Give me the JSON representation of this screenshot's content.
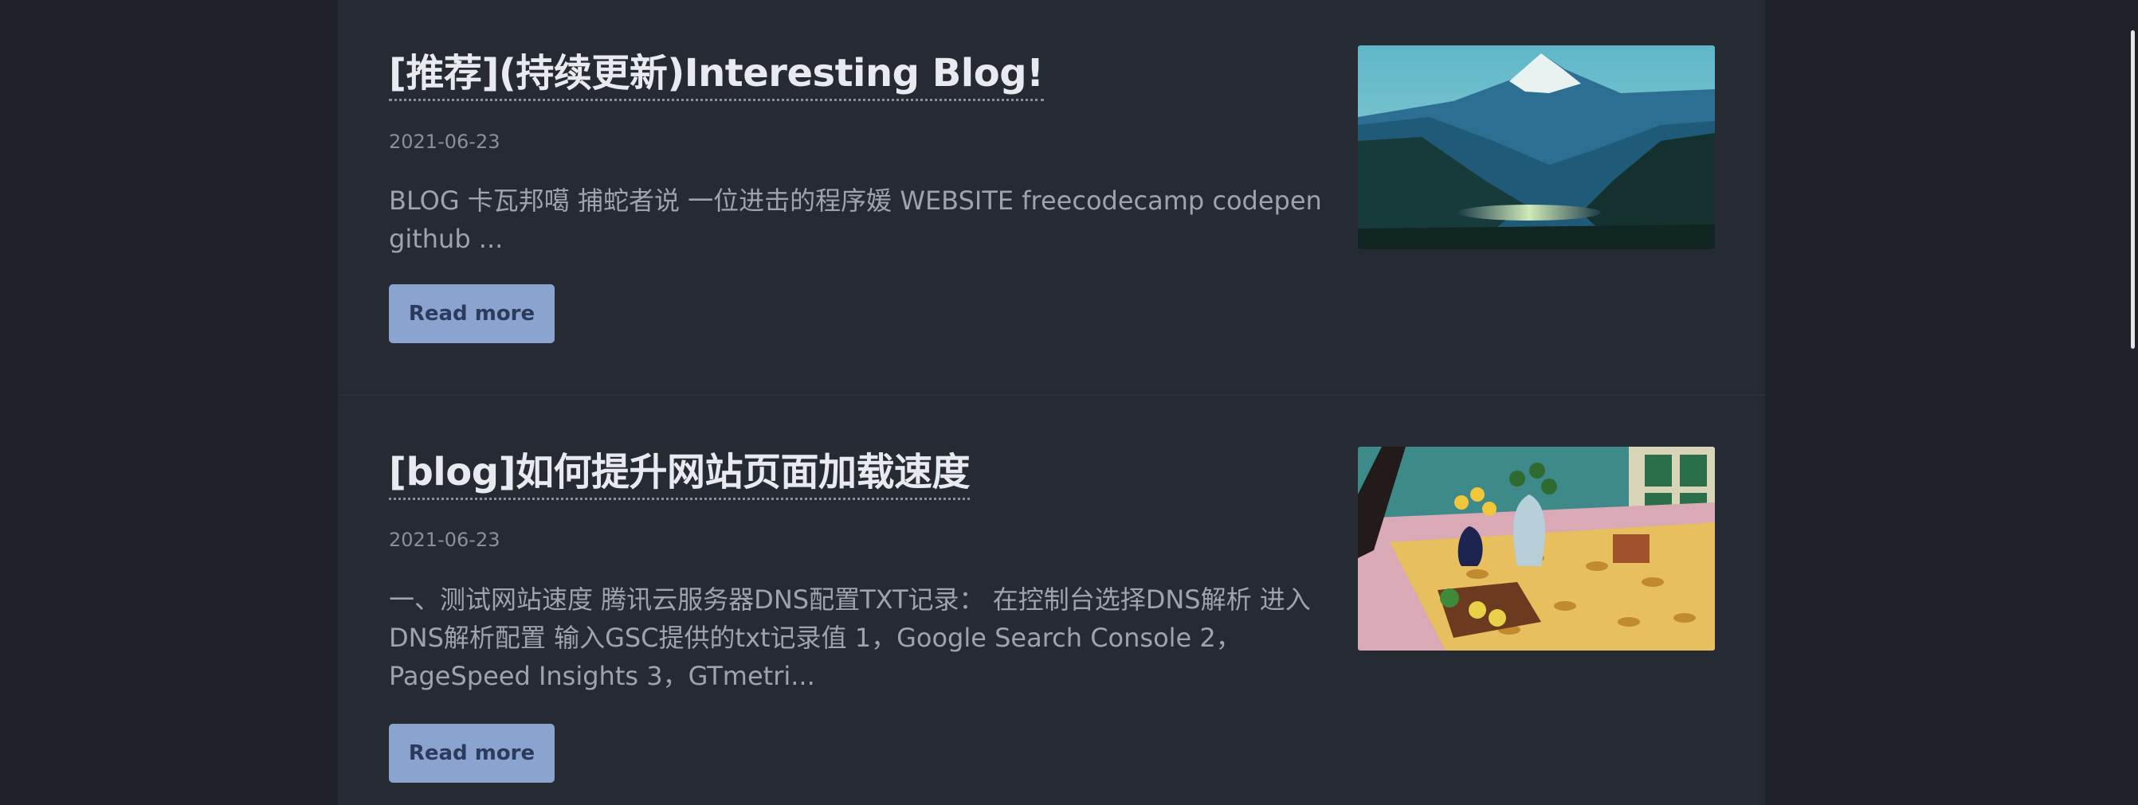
{
  "posts": [
    {
      "title": "[推荐](持续更新)Interesting Blog!",
      "date": "2021-06-23",
      "excerpt": "BLOG 卡瓦邦噶 捕蛇者说 一位进击的程序媛 WEBSITE freecodecamp codepen github ...",
      "read_more": "Read more",
      "image": "mountain-lake-painting"
    },
    {
      "title": "[blog]如何提升网站页面加载速度",
      "date": "2021-06-23",
      "excerpt": "一、测试网站速度 腾讯云服务器DNS配置TXT记录： 在控制台选择DNS解析 进入DNS解析配置 输入GSC提供的txt记录值 1，Google Search Console 2，PageSpeed Insights 3，GTmetri...",
      "read_more": "Read more",
      "image": "still-life-flowers-painting"
    }
  ],
  "colors": {
    "page_background": "#1f2229",
    "content_background": "#262a33",
    "title": "#e8eaef",
    "date": "#8a8f99",
    "excerpt": "#9ea3ad",
    "button_background": "#8aa3cf",
    "button_text": "#2a3b5c"
  }
}
